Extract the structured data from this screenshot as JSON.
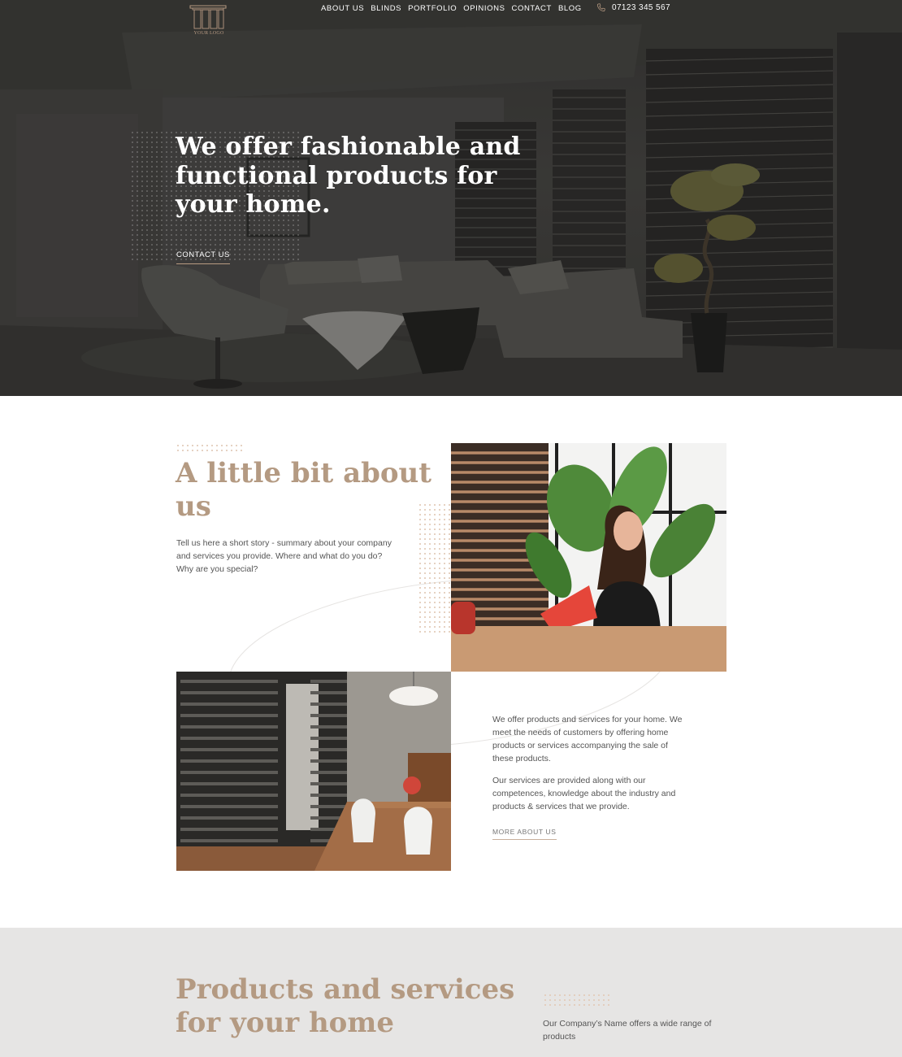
{
  "brand": {
    "logo_text": "YOUR LOGO",
    "accent": "#b49a82"
  },
  "nav": {
    "items": [
      {
        "label": "ABOUT US"
      },
      {
        "label": "BLINDS"
      },
      {
        "label": "PORTFOLIO"
      },
      {
        "label": "OPINIONS"
      },
      {
        "label": "CONTACT"
      },
      {
        "label": "BLOG"
      }
    ],
    "phone": "07123 345 567",
    "phone_icon": "phone-icon"
  },
  "hero": {
    "title": "We offer fashionable and functional products for your home.",
    "cta": "CONTACT US"
  },
  "about": {
    "title": "A little bit about us",
    "intro": "Tell us here a short story - summary about your company and services you provide. Where and what do you do? Why are you special?",
    "body": [
      "We offer products and services for your home. We meet the needs of customers by offering home products or services accompanying the sale of these products.",
      "Our services are provided along with our competences, knowledge about the industry and products & services that we provide."
    ],
    "more_link": "MORE ABOUT US"
  },
  "products": {
    "title": "Products and services for your home",
    "text": "Our Company’s Name offers a wide range of products"
  }
}
